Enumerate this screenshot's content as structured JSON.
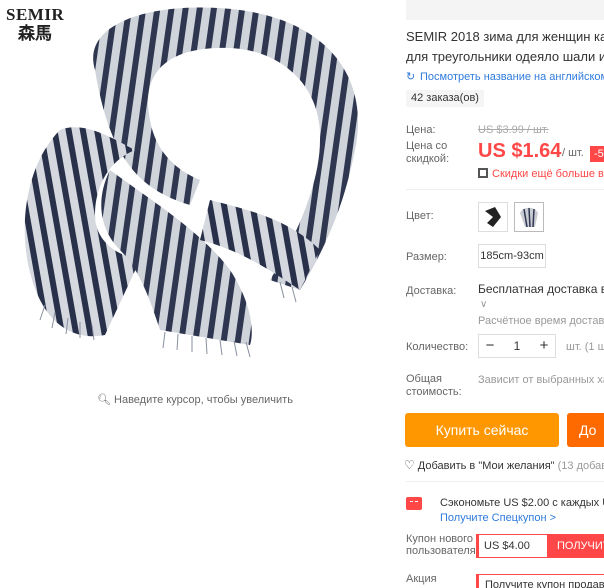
{
  "brand": {
    "logo_text": "SEMIR",
    "logo_cn": "森馬"
  },
  "gallery": {
    "zoom_hint": "Наведите курсор, чтобы увеличить"
  },
  "product": {
    "title_line1": "SEMIR 2018 зима для женщин каш",
    "title_line2": "для треугольники одеяло шали и",
    "translate_link": "Посмотреть название на английском",
    "orders": "42 заказа(ов)"
  },
  "price": {
    "label_price": "Цена:",
    "old_price": "US $3.99 / шт.",
    "label_discount_1": "Цена со",
    "label_discount_2": "скидкой:",
    "new_price": "US $1.64",
    "per_unit": "/ шт.",
    "discount_badge": "-5",
    "sale_note": "Скидки ещё больше в P"
  },
  "options": {
    "color_label": "Цвет:",
    "size_label": "Размер:",
    "size_value": "185cm-93cm",
    "shipping_label": "Доставка:",
    "shipping_value": "Бесплатная доставка в Р",
    "shipping_time": "Расчётное время доставки",
    "qty_label": "Количество:",
    "qty_minus": "−",
    "qty_value": "1",
    "qty_plus": "+",
    "qty_unit": "шт. (1 ш",
    "total_label_1": "Общая",
    "total_label_2": "стоимость:",
    "total_value": "Зависит от выбранных ха"
  },
  "actions": {
    "buy_now": "Купить сейчас",
    "add_to_cart": "До",
    "wishlist": "Добавить в \"Мои желания\"",
    "wishlist_count": "(13 добав"
  },
  "coupons": {
    "save_text": "Сэкономьте US $2.00 с каждых US",
    "get_coupon": "Получите Спецкупон >",
    "new_user_label_1": "Купон нового",
    "new_user_label_2": "пользователя",
    "new_user_amount": "US $4.00",
    "new_user_get": "ПОЛУЧИТ",
    "action_label": "Акция",
    "action_text": "Получите купон продав"
  },
  "colors": {
    "accent_red": "#ff4747",
    "buy_orange": "#ff9700",
    "cart_orange": "#ff6a00",
    "link_blue": "#2f7bdc"
  }
}
